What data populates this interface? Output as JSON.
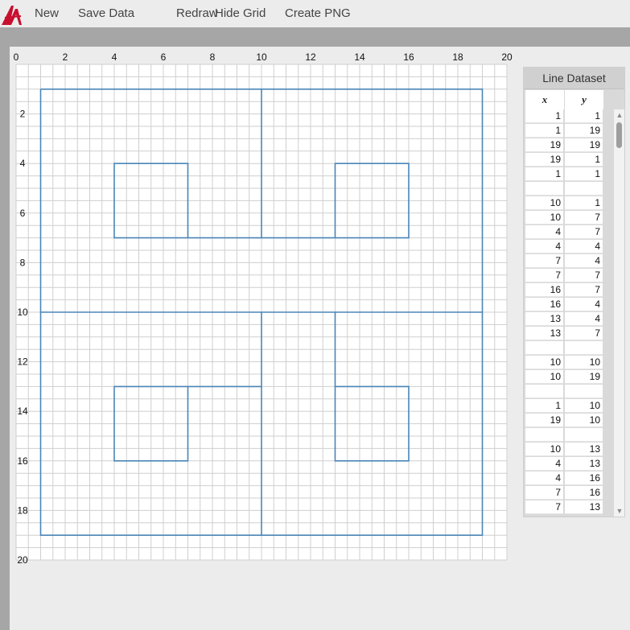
{
  "menu": {
    "items": [
      {
        "name": "menu-new",
        "label": "New"
      },
      {
        "name": "menu-save-data",
        "label": "Save Data"
      },
      {
        "name": "menu-redraw",
        "label": "Redraw"
      },
      {
        "name": "menu-hide-grid",
        "label": "Hide Grid"
      },
      {
        "name": "menu-create-png",
        "label": "Create PNG"
      }
    ]
  },
  "colors": {
    "accent": "#c8102e",
    "line": "#4a86b8",
    "grid": "#cfcfcf"
  },
  "panel": {
    "title": "Line Dataset",
    "x_header": "x",
    "y_header": "y",
    "rows": [
      [
        "1",
        "1"
      ],
      [
        "1",
        "19"
      ],
      [
        "19",
        "19"
      ],
      [
        "19",
        "1"
      ],
      [
        "1",
        "1"
      ],
      [
        "",
        ""
      ],
      [
        "10",
        "1"
      ],
      [
        "10",
        "7"
      ],
      [
        "4",
        "7"
      ],
      [
        "4",
        "4"
      ],
      [
        "7",
        "4"
      ],
      [
        "7",
        "7"
      ],
      [
        "16",
        "7"
      ],
      [
        "16",
        "4"
      ],
      [
        "13",
        "4"
      ],
      [
        "13",
        "7"
      ],
      [
        "",
        ""
      ],
      [
        "10",
        "10"
      ],
      [
        "10",
        "19"
      ],
      [
        "",
        ""
      ],
      [
        "1",
        "10"
      ],
      [
        "19",
        "10"
      ],
      [
        "",
        ""
      ],
      [
        "10",
        "13"
      ],
      [
        "4",
        "13"
      ],
      [
        "4",
        "16"
      ],
      [
        "7",
        "16"
      ],
      [
        "7",
        "13"
      ]
    ]
  },
  "chart_data": {
    "type": "line",
    "xlim": [
      0,
      20
    ],
    "ylim": [
      0,
      20
    ],
    "y_inverted": true,
    "grid": true,
    "x_ticks": [
      "0",
      "2",
      "4",
      "6",
      "8",
      "10",
      "12",
      "14",
      "16",
      "18",
      "20"
    ],
    "y_ticks": [
      "2",
      "4",
      "6",
      "8",
      "10",
      "12",
      "14",
      "16",
      "18",
      "20"
    ],
    "series": [
      {
        "points": [
          [
            1,
            1
          ],
          [
            1,
            19
          ],
          [
            19,
            19
          ],
          [
            19,
            1
          ],
          [
            1,
            1
          ]
        ]
      },
      {
        "points": [
          [
            10,
            1
          ],
          [
            10,
            7
          ],
          [
            4,
            7
          ],
          [
            4,
            4
          ],
          [
            7,
            4
          ],
          [
            7,
            7
          ],
          [
            16,
            7
          ],
          [
            16,
            4
          ],
          [
            13,
            4
          ],
          [
            13,
            7
          ]
        ]
      },
      {
        "points": [
          [
            10,
            10
          ],
          [
            10,
            19
          ]
        ]
      },
      {
        "points": [
          [
            1,
            10
          ],
          [
            19,
            10
          ]
        ]
      },
      {
        "points": [
          [
            10,
            13
          ],
          [
            4,
            13
          ],
          [
            4,
            16
          ],
          [
            7,
            16
          ],
          [
            7,
            13
          ]
        ]
      },
      {
        "points": [
          [
            13,
            10
          ],
          [
            13,
            16
          ],
          [
            16,
            16
          ],
          [
            16,
            13
          ],
          [
            13,
            13
          ]
        ]
      }
    ]
  }
}
